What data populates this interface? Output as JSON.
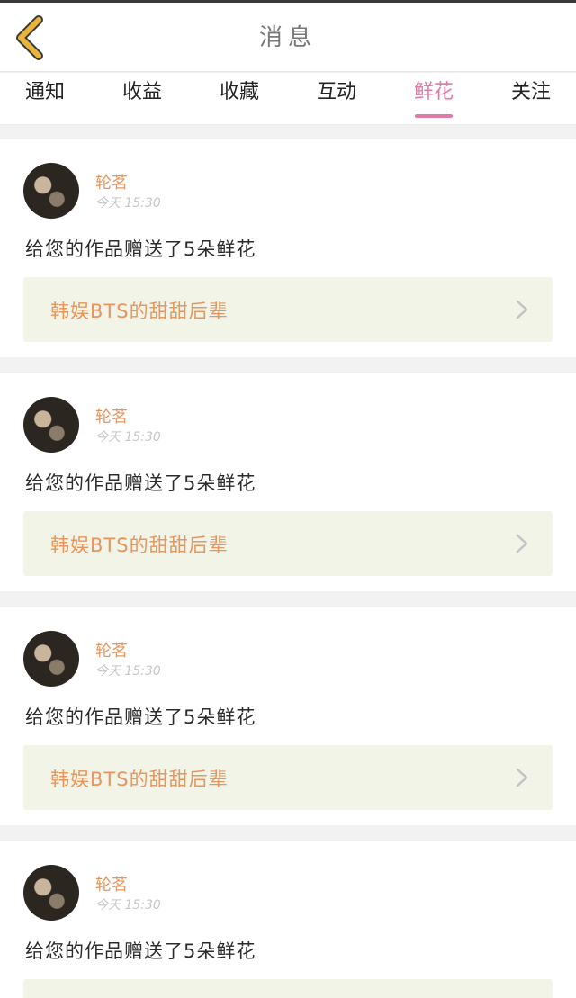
{
  "header": {
    "title": "消息"
  },
  "tabs": [
    {
      "label": "通知",
      "active": false
    },
    {
      "label": "收益",
      "active": false
    },
    {
      "label": "收藏",
      "active": false
    },
    {
      "label": "互动",
      "active": false
    },
    {
      "label": "鲜花",
      "active": true
    },
    {
      "label": "关注",
      "active": false
    }
  ],
  "colors": {
    "accent_pink": "#e07aa7",
    "name_orange": "#e6965e",
    "back_yellow": "#e8b43a",
    "work_box_bg": "#f1f4e6"
  },
  "messages": [
    {
      "username": "轮茗",
      "time": "今天 15:30",
      "text": "给您的作品赠送了5朵鲜花",
      "work_title": "韩娱BTS的甜甜后辈"
    },
    {
      "username": "轮茗",
      "time": "今天 15:30",
      "text": "给您的作品赠送了5朵鲜花",
      "work_title": "韩娱BTS的甜甜后辈"
    },
    {
      "username": "轮茗",
      "time": "今天 15:30",
      "text": "给您的作品赠送了5朵鲜花",
      "work_title": "韩娱BTS的甜甜后辈"
    },
    {
      "username": "轮茗",
      "time": "今天 15:30",
      "text": "给您的作品赠送了5朵鲜花",
      "work_title": ""
    }
  ]
}
